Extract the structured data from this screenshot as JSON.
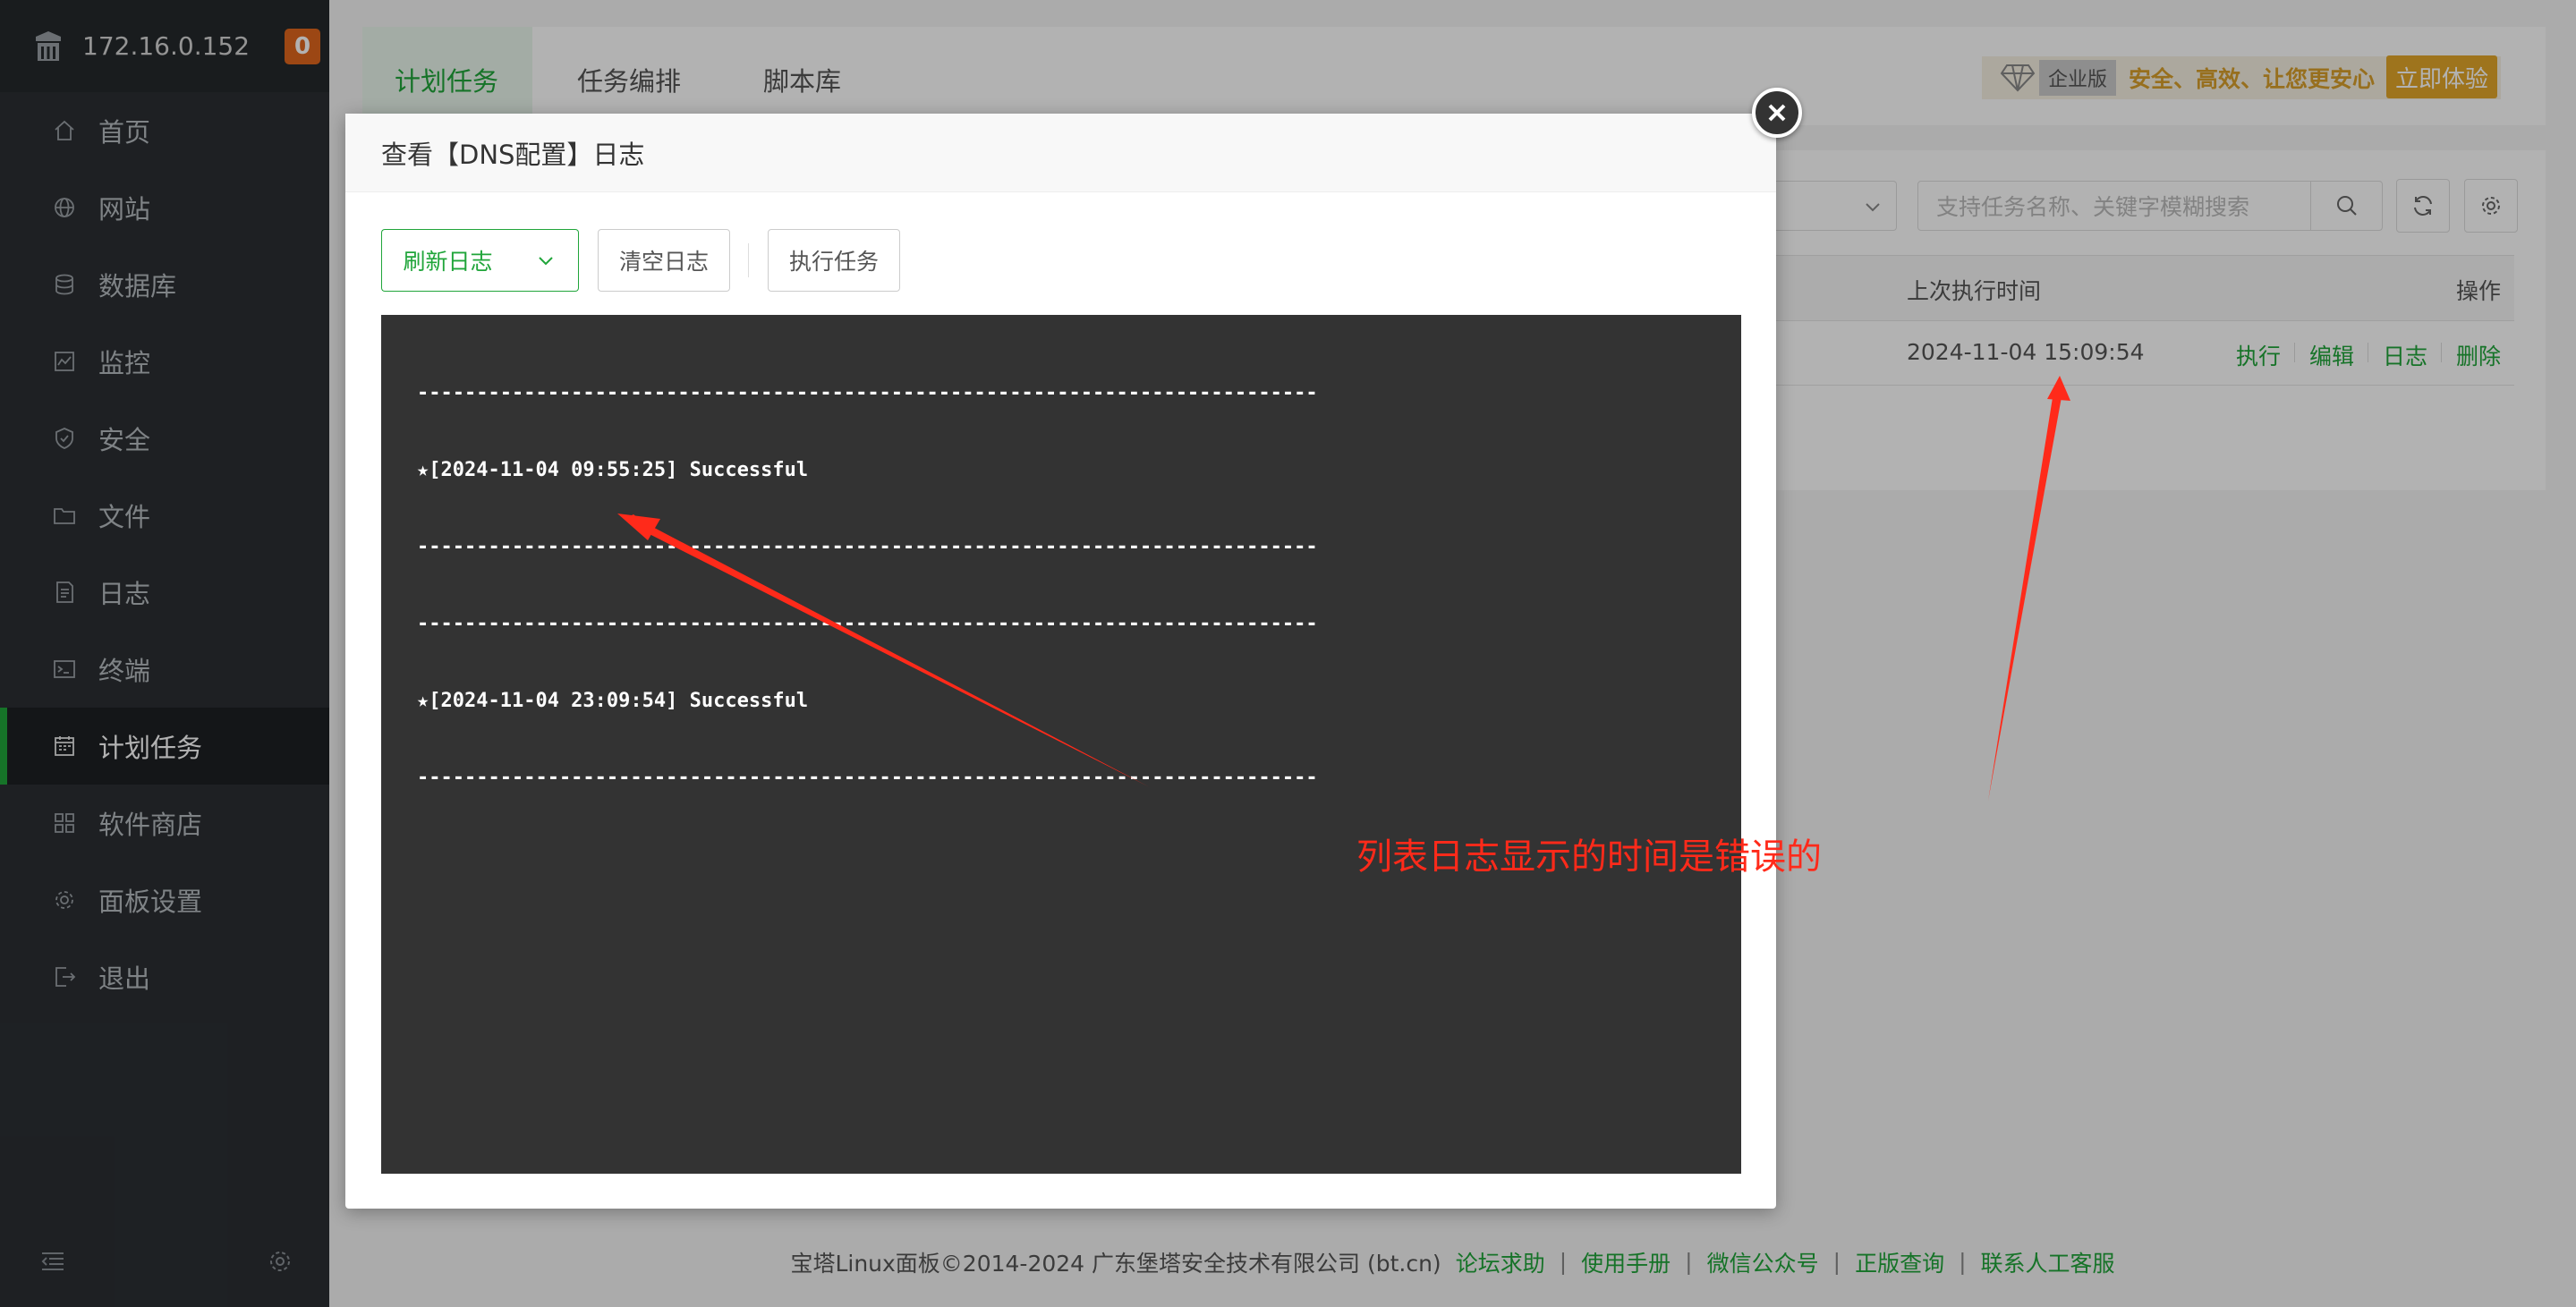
{
  "sidebar": {
    "ip": "172.16.0.152",
    "badge": "0",
    "items": [
      {
        "label": "首页",
        "icon": "home-icon"
      },
      {
        "label": "网站",
        "icon": "globe-icon"
      },
      {
        "label": "数据库",
        "icon": "database-icon"
      },
      {
        "label": "监控",
        "icon": "monitor-icon"
      },
      {
        "label": "安全",
        "icon": "shield-icon"
      },
      {
        "label": "文件",
        "icon": "folder-icon"
      },
      {
        "label": "日志",
        "icon": "document-icon"
      },
      {
        "label": "终端",
        "icon": "terminal-icon"
      },
      {
        "label": "计划任务",
        "icon": "calendar-icon",
        "active": true
      },
      {
        "label": "软件商店",
        "icon": "grid-icon"
      },
      {
        "label": "面板设置",
        "icon": "gear-icon"
      },
      {
        "label": "退出",
        "icon": "logout-icon"
      }
    ]
  },
  "tabs": [
    "计划任务",
    "任务编排",
    "脚本库"
  ],
  "promo": {
    "tag": "企业版",
    "text": "安全、高效、让您更安心",
    "button": "立即体验"
  },
  "search": {
    "placeholder": "支持任务名称、关键字模糊搜索"
  },
  "table": {
    "headers": {
      "last_run": "上次执行时间",
      "ops": "操作"
    },
    "row": {
      "last_run": "2024-11-04 15:09:54",
      "ops": [
        "执行",
        "编辑",
        "日志",
        "删除"
      ]
    }
  },
  "modal": {
    "title": "查看【DNS配置】日志",
    "buttons": {
      "refresh": "刷新日志",
      "clear": "清空日志",
      "run": "执行任务"
    },
    "log_lines": [
      "----------------------------------------------------------------------------",
      "★[2024-11-04 09:55:25] Successful",
      "----------------------------------------------------------------------------",
      "----------------------------------------------------------------------------",
      "★[2024-11-04 23:09:54] Successful",
      "----------------------------------------------------------------------------"
    ]
  },
  "annotation": {
    "text": "列表日志显示的时间是错误的",
    "color": "#ff2a1a"
  },
  "footer": {
    "copyright": "宝塔Linux面板©2014-2024 广东堡塔安全技术有限公司 (bt.cn)",
    "links": [
      "论坛求助",
      "使用手册",
      "微信公众号",
      "正版查询",
      "联系人工客服"
    ]
  },
  "colors": {
    "accent": "#20a53a",
    "sidebar": "#2b2f33",
    "badge": "#e0661e",
    "promo": "#e3a72a"
  }
}
